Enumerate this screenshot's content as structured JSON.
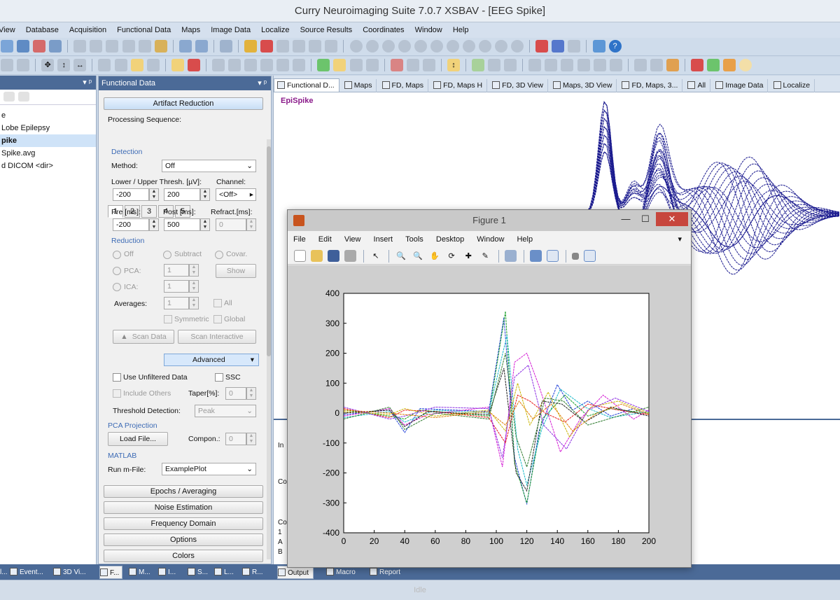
{
  "window": {
    "title": "Curry Neuroimaging Suite 7.0.7 XSBAV - [EEG Spike]"
  },
  "menu": [
    "View",
    "Database",
    "Acquisition",
    "Functional Data",
    "Maps",
    "Image Data",
    "Localize",
    "Source Results",
    "Coordinates",
    "Window",
    "Help"
  ],
  "left_panel": {
    "items": [
      "e",
      "Lobe Epilepsy",
      "pike",
      "Spike.avg",
      "d DICOM <dir>"
    ]
  },
  "fd_panel": {
    "title": "Functional Data",
    "artifact_reduction": "Artifact Reduction",
    "processing_sequence": "Processing Sequence:",
    "seq_tabs": [
      "1",
      "2",
      "3",
      "4",
      "5"
    ],
    "detection": {
      "header": "Detection",
      "method_label": "Method:",
      "method_value": "Off",
      "thresh_label": "Lower / Upper Thresh. [µV]:",
      "channel_label": "Channel:",
      "lower": "-200",
      "upper": "200",
      "channel_value": "<Off>",
      "pre_label": "Pre [ms]:",
      "post_label": "Post [ms]:",
      "refract_label": "Refract.[ms]:",
      "pre": "-200",
      "post": "500",
      "refract": "0"
    },
    "reduction": {
      "header": "Reduction",
      "off": "Off",
      "subtract": "Subtract",
      "covar": "Covar.",
      "pca": "PCA:",
      "pca_val": "1",
      "show": "Show",
      "ica": "ICA:",
      "ica_val": "1",
      "averages": "Averages:",
      "averages_val": "1",
      "all": "All",
      "symmetric": "Symmetric",
      "global": "Global",
      "scan_data": "Scan Data",
      "scan_interactive": "Scan Interactive"
    },
    "advanced": "Advanced",
    "use_unfiltered": "Use Unfiltered Data",
    "ssc": "SSC",
    "include_others": "Include Others",
    "taper_label": "Taper[%]:",
    "taper_val": "0",
    "threshold_detection_label": "Threshold Detection:",
    "threshold_detection_val": "Peak",
    "pca_projection": "PCA Projection",
    "load_file": "Load File...",
    "compon_label": "Compon.:",
    "compon_val": "0",
    "matlab": "MATLAB",
    "run_mfile_label": "Run m-File:",
    "run_mfile_val": "ExamplePlot",
    "sections": [
      "Epochs / Averaging",
      "Noise Estimation",
      "Frequency Domain",
      "Options",
      "Colors"
    ]
  },
  "view_tabs": [
    "Functional D...",
    "Maps",
    "FD, Maps",
    "FD, Maps H",
    "FD, 3D View",
    "Maps, 3D View",
    "FD, Maps, 3...",
    "All",
    "Image Data",
    "Localize"
  ],
  "epispike_label": "EpiSpike",
  "output_lines": [
    "In",
    "Co",
    "Co",
    "1",
    "A",
    "B"
  ],
  "bottom_tabs_left": [
    "l...",
    "Event...",
    "3D Vi..."
  ],
  "bottom_tabs_mid": [
    "F...",
    "M...",
    "I...",
    "S...",
    "L...",
    "R..."
  ],
  "bottom_tabs_right": [
    "Output",
    "Macro",
    "Report"
  ],
  "status": "Idle",
  "figure": {
    "title": "Figure 1",
    "menu": [
      "File",
      "Edit",
      "View",
      "Insert",
      "Tools",
      "Desktop",
      "Window",
      "Help"
    ],
    "chart_data": {
      "type": "line",
      "xlim": [
        0,
        200
      ],
      "ylim": [
        -400,
        400
      ],
      "xticks": [
        0,
        20,
        40,
        60,
        80,
        100,
        120,
        140,
        160,
        180,
        200
      ],
      "yticks": [
        400,
        300,
        200,
        100,
        0,
        -100,
        -200,
        -300,
        -400
      ],
      "series": [
        {
          "color": "#1f3fd8",
          "values": [
            [
              0,
              -5
            ],
            [
              30,
              10
            ],
            [
              40,
              -65
            ],
            [
              50,
              15
            ],
            [
              95,
              5
            ],
            [
              105,
              320
            ],
            [
              112,
              -150
            ],
            [
              120,
              -305
            ],
            [
              128,
              -60
            ],
            [
              140,
              95
            ],
            [
              150,
              10
            ],
            [
              160,
              40
            ],
            [
              175,
              -10
            ],
            [
              190,
              15
            ],
            [
              200,
              -5
            ]
          ]
        },
        {
          "color": "#1a9f2a",
          "values": [
            [
              0,
              10
            ],
            [
              30,
              -10
            ],
            [
              40,
              -20
            ],
            [
              50,
              10
            ],
            [
              95,
              -10
            ],
            [
              106,
              340
            ],
            [
              112,
              -170
            ],
            [
              120,
              -300
            ],
            [
              130,
              -20
            ],
            [
              145,
              60
            ],
            [
              160,
              -10
            ],
            [
              175,
              15
            ],
            [
              190,
              5
            ],
            [
              200,
              0
            ]
          ]
        },
        {
          "color": "#d41ad4",
          "values": [
            [
              0,
              -10
            ],
            [
              30,
              15
            ],
            [
              40,
              -40
            ],
            [
              55,
              -5
            ],
            [
              95,
              20
            ],
            [
              104,
              -180
            ],
            [
              112,
              170
            ],
            [
              120,
              200
            ],
            [
              128,
              90
            ],
            [
              142,
              -130
            ],
            [
              155,
              -20
            ],
            [
              170,
              60
            ],
            [
              190,
              -20
            ],
            [
              200,
              10
            ]
          ]
        },
        {
          "color": "#e81818",
          "values": [
            [
              0,
              15
            ],
            [
              30,
              -15
            ],
            [
              40,
              10
            ],
            [
              60,
              5
            ],
            [
              95,
              -15
            ],
            [
              106,
              -100
            ],
            [
              114,
              60
            ],
            [
              122,
              40
            ],
            [
              132,
              0
            ],
            [
              145,
              -30
            ],
            [
              160,
              30
            ],
            [
              180,
              10
            ],
            [
              200,
              -5
            ]
          ]
        },
        {
          "color": "#18b9c9",
          "values": [
            [
              0,
              -15
            ],
            [
              30,
              5
            ],
            [
              40,
              -30
            ],
            [
              60,
              10
            ],
            [
              95,
              0
            ],
            [
              107,
              260
            ],
            [
              114,
              -120
            ],
            [
              120,
              -240
            ],
            [
              130,
              -50
            ],
            [
              142,
              80
            ],
            [
              158,
              20
            ],
            [
              175,
              -15
            ],
            [
              200,
              5
            ]
          ]
        },
        {
          "color": "#c9b400",
          "values": [
            [
              0,
              5
            ],
            [
              30,
              -5
            ],
            [
              40,
              15
            ],
            [
              60,
              -10
            ],
            [
              95,
              10
            ],
            [
              106,
              -60
            ],
            [
              114,
              100
            ],
            [
              122,
              -40
            ],
            [
              134,
              70
            ],
            [
              148,
              -80
            ],
            [
              162,
              20
            ],
            [
              180,
              40
            ],
            [
              200,
              0
            ]
          ]
        },
        {
          "color": "#202020",
          "values": [
            [
              0,
              0
            ],
            [
              30,
              10
            ],
            [
              40,
              -45
            ],
            [
              55,
              5
            ],
            [
              95,
              -5
            ],
            [
              105,
              150
            ],
            [
              113,
              -200
            ],
            [
              120,
              -260
            ],
            [
              130,
              40
            ],
            [
              143,
              30
            ],
            [
              158,
              -30
            ],
            [
              175,
              20
            ],
            [
              200,
              -10
            ]
          ]
        },
        {
          "color": "#8a2be2",
          "values": [
            [
              0,
              20
            ],
            [
              30,
              -20
            ],
            [
              40,
              -10
            ],
            [
              60,
              20
            ],
            [
              95,
              15
            ],
            [
              104,
              -150
            ],
            [
              112,
              120
            ],
            [
              121,
              160
            ],
            [
              131,
              -40
            ],
            [
              146,
              -120
            ],
            [
              160,
              10
            ],
            [
              178,
              50
            ],
            [
              200,
              5
            ]
          ]
        },
        {
          "color": "#2d7a2d",
          "values": [
            [
              0,
              -20
            ],
            [
              30,
              20
            ],
            [
              40,
              -55
            ],
            [
              60,
              0
            ],
            [
              95,
              -20
            ],
            [
              106,
              200
            ],
            [
              113,
              -80
            ],
            [
              120,
              -180
            ],
            [
              132,
              50
            ],
            [
              144,
              40
            ],
            [
              160,
              -40
            ],
            [
              180,
              -10
            ],
            [
              200,
              20
            ]
          ]
        },
        {
          "color": "#e07b00",
          "values": [
            [
              0,
              10
            ],
            [
              30,
              0
            ],
            [
              40,
              -5
            ],
            [
              60,
              -15
            ],
            [
              95,
              5
            ],
            [
              106,
              -40
            ],
            [
              115,
              40
            ],
            [
              124,
              -20
            ],
            [
              136,
              30
            ],
            [
              150,
              -60
            ],
            [
              166,
              0
            ],
            [
              182,
              30
            ],
            [
              200,
              -5
            ]
          ]
        }
      ]
    }
  }
}
